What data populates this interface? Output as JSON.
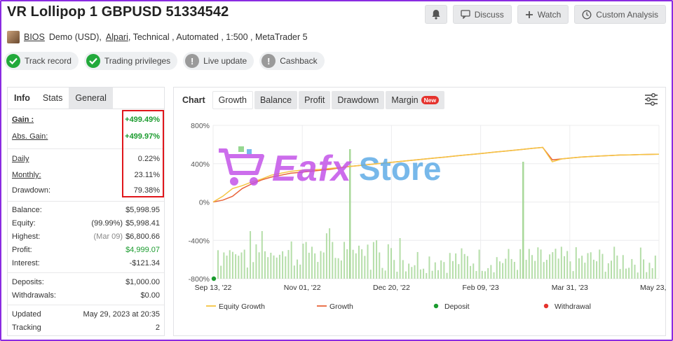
{
  "header": {
    "title": "VR Lollipop 1 GBPUSD 51334542",
    "actions": {
      "discuss_label": "Discuss",
      "watch_label": "Watch",
      "custom_analysis_label": "Custom Analysis"
    }
  },
  "subline": {
    "author": "BIOS",
    "account_type": "Demo (USD),",
    "broker": "Alpari",
    "details": ", Technical , Automated , 1:500 , MetaTrader 5"
  },
  "badges": [
    {
      "label": "Track record",
      "state": "ok"
    },
    {
      "label": "Trading privileges",
      "state": "ok"
    },
    {
      "label": "Live update",
      "state": "warn"
    },
    {
      "label": "Cashback",
      "state": "warn"
    }
  ],
  "left_tabs": [
    "Info",
    "Stats",
    "General"
  ],
  "stats": {
    "gain_label": "Gain :",
    "gain_value": "+499.49%",
    "abs_gain_label": "Abs. Gain:",
    "abs_gain_value": "+499.97%",
    "daily_label": "Daily",
    "daily_value": "0.22%",
    "monthly_label": "Monthly:",
    "monthly_value": "23.11%",
    "drawdown_label": "Drawdown:",
    "drawdown_value": "79.38%",
    "balance_label": "Balance:",
    "balance_value": "$5,998.95",
    "equity_label": "Equity:",
    "equity_pct": "(99.99%)",
    "equity_value": "$5,998.41",
    "highest_label": "Highest:",
    "highest_date": "(Mar 09)",
    "highest_value": "$6,800.66",
    "profit_label": "Profit:",
    "profit_value": "$4,999.07",
    "interest_label": "Interest:",
    "interest_value": "-$121.34",
    "deposits_label": "Deposits:",
    "deposits_value": "$1,000.00",
    "withdrawals_label": "Withdrawals:",
    "withdrawals_value": "$0.00",
    "updated_label": "Updated",
    "updated_value": "May 29, 2023 at 20:35",
    "tracking_label": "Tracking",
    "tracking_value": "2"
  },
  "chart_tabs": {
    "chart": "Chart",
    "growth": "Growth",
    "balance": "Balance",
    "profit": "Profit",
    "drawdown": "Drawdown",
    "margin": "Margin",
    "new_badge": "New"
  },
  "watermark": {
    "part1": "Eafx",
    "part2": "Store"
  },
  "colors": {
    "equity": "#f5c542",
    "growth": "#e8643a",
    "bars": "#a8d89a",
    "deposit": "#1a9b2e",
    "withdrawal": "#e5322d"
  },
  "chart_data": {
    "type": "line",
    "yticks": [
      "800%",
      "400%",
      "0%",
      "-400%",
      "-800%"
    ],
    "ylim": [
      -800,
      800
    ],
    "xticks": [
      "Sep 13, '22",
      "Nov 01, '22",
      "Dec 20, '22",
      "Feb 09, '23",
      "Mar 31, '23",
      "May 23, '23"
    ],
    "legend": [
      "Equity Growth",
      "Growth",
      "Deposit",
      "Withdrawal"
    ],
    "series": [
      {
        "name": "Growth",
        "values": [
          0,
          20,
          60,
          140,
          190,
          230,
          260,
          280,
          300,
          310,
          320,
          330,
          340,
          355,
          370,
          380,
          390,
          400,
          410,
          420,
          430,
          440,
          450,
          460,
          470,
          480,
          490,
          500,
          510,
          520,
          530,
          540,
          550,
          560,
          570,
          440,
          450,
          460,
          470,
          475,
          480,
          485,
          490,
          492,
          495,
          497,
          499
        ]
      },
      {
        "name": "Equity Growth",
        "values": [
          0,
          60,
          140,
          170,
          210,
          240,
          280,
          300,
          320,
          330,
          335,
          340,
          350,
          360,
          370,
          380,
          390,
          400,
          410,
          420,
          430,
          440,
          450,
          460,
          470,
          480,
          490,
          500,
          510,
          520,
          530,
          540,
          550,
          560,
          570,
          420,
          450,
          460,
          470,
          475,
          480,
          485,
          490,
          492,
          495,
          497,
          499
        ]
      }
    ]
  }
}
